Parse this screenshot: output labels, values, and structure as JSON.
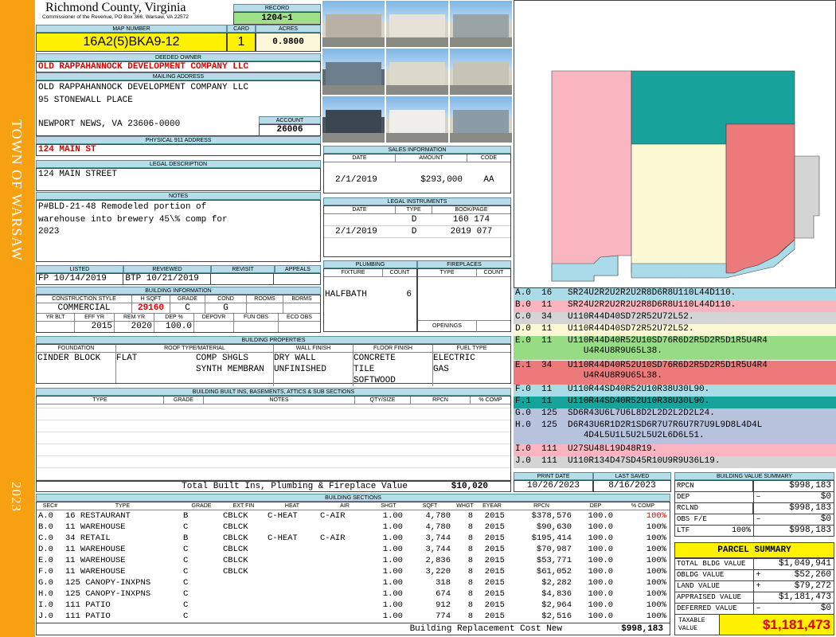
{
  "side": {
    "town": "TOWN OF WARSAW",
    "year": "2023"
  },
  "header": {
    "county": "Richmond County, Virginia",
    "commissioner": "Commissioner of the Revenue, PO Box 366, Warsaw, VA 22572",
    "record_label": "RECORD",
    "record": "1204~1",
    "map_number_label": "MAP NUMBER",
    "map_number": "16A2(5)BKA9-12",
    "card_label": "CARD",
    "card": "1",
    "acres_label": "ACRES",
    "acres": "0.9800"
  },
  "owner": {
    "deeded_label": "DEEDED OWNER",
    "deeded_owner": "OLD RAPPAHANNOCK DEVELOPMENT COMPANY LLC",
    "mailing_label": "MAILING ADDRESS",
    "mailing_line1": "OLD RAPPAHANNOCK DEVELOPMENT COMPANY LLC",
    "mailing_line2": "95 STONEWALL PLACE",
    "mailing_line3": "NEWPORT NEWS, VA 23606-0000",
    "account_label": "ACCOUNT",
    "account": "26006"
  },
  "physical": {
    "label": "PHYSICAL 911 ADDRESS",
    "value": "124 MAIN ST"
  },
  "legal": {
    "label": "LEGAL DESCRIPTION",
    "value": "124 MAIN STREET"
  },
  "notes": {
    "label": "NOTES",
    "line1": "P#BLD-21-48 Remodeled portion of",
    "line2": "warehouse into brewery 45\\% comp for",
    "line3": "2023"
  },
  "dates": {
    "listed_label": "LISTED",
    "listed": "FP  10/14/2019",
    "reviewed_label": "REVIEWED",
    "reviewed": "BTP 10/21/2019",
    "revisit_label": "REVISIT",
    "appeals_label": "APPEALS"
  },
  "building_info": {
    "label": "BUILDING INFORMATION",
    "h_style": "CONSTRUCTION STYLE",
    "h_sqft": "H SQFT",
    "h_grade": "GRADE",
    "h_cond": "COND",
    "h_rooms": "ROOMS",
    "h_bdrms": "BDRMS",
    "style": "COMMERCIAL",
    "sqft": "29160",
    "grade": "C",
    "cond": "G",
    "h_yrblt": "YR BLT",
    "h_effyr": "EFF YR",
    "h_remyr": "REM YR",
    "h_dep": "DEP %",
    "h_depovr": "DEPOVR",
    "h_funobs": "FUN OBS",
    "h_ecoobs": "ECO OBS",
    "effyr": "2015",
    "remyr": "2020",
    "dep": "100.0"
  },
  "sales": {
    "label": "SALES INFORMATION",
    "h_date": "DATE",
    "h_amount": "AMOUNT",
    "h_code": "CODE",
    "date": "2/1/2019",
    "amount": "$293,000",
    "code": "AA"
  },
  "instruments": {
    "label": "LEGAL INSTRUMENTS",
    "h_date": "DATE",
    "h_type": "TYPE",
    "h_book": "BOOK/PAGE",
    "rows": [
      {
        "date": "",
        "type": "D",
        "book": "160 174"
      },
      {
        "date": "2/1/2019",
        "type": "D",
        "book": "2019 077"
      }
    ]
  },
  "plumbing": {
    "label": "PLUMBING",
    "h_fixture": "FIXTURE",
    "h_count": "COUNT",
    "fixture": "HALFBATH",
    "count": "6"
  },
  "fireplaces": {
    "label": "FIREPLACES",
    "h_type": "TYPE",
    "h_count": "COUNT",
    "openings": "OPENINGS"
  },
  "properties": {
    "label": "BUILDING PROPERTIES",
    "h_foundation": "FOUNDATION",
    "h_roof": "ROOF TYPE/MATERIAL",
    "h_wall": "WALL FINISH",
    "h_floor": "FLOOR FINISH",
    "h_fuel": "FUEL TYPE",
    "foundation": "CINDER BLOCK",
    "roof_type": "FLAT",
    "roof_mat1": "COMP SHGLS",
    "roof_mat2": "SYNTH MEMBRAN",
    "wall1": "DRY WALL",
    "wall2": "UNFINISHED",
    "floor1": "CONCRETE",
    "floor2": "TILE",
    "floor3": "SOFTWOOD",
    "fuel1": "ELECTRIC",
    "fuel2": "GAS"
  },
  "builtins": {
    "label": "BUILDING BUILT INS, BASEMENTS, ATTICS & SUB SECTIONS",
    "h_type": "TYPE",
    "h_grade": "GRADE",
    "h_notes": "NOTES",
    "h_qty": "QTY/SIZE",
    "h_rpcn": "RPCN",
    "h_comp": "% COMP",
    "total_label": "Total Built Ins, Plumbing & Fireplace Value",
    "total": "$10,020"
  },
  "print": {
    "print_label": "PRINT DATE",
    "print_date": "10/26/2023",
    "last_label": "LAST SAVED",
    "last_saved": "8/16/2023"
  },
  "sketch": {
    "colors": {
      "pink": "#f9b6c1",
      "teal": "#17a39c",
      "cream": "#fdf8d4",
      "salmon": "#ec7a7a",
      "lightblue": "#a9dbe9",
      "gray": "#d4d4d4",
      "green": "#95dc82",
      "navy": "#b7c3dd"
    },
    "segments": [
      {
        "label": "A.0",
        "code": "16",
        "text": "SR24U2R2U2R2U2R8D6R8U110L44D110."
      },
      {
        "label": "B.0",
        "code": "11",
        "text": "SR24U2R2U2R2U2R8D6R8U110L44D110."
      },
      {
        "label": "C.0",
        "code": "34",
        "text": "U110R44D40SD72R52U72L52."
      },
      {
        "label": "D.0",
        "code": "11",
        "text": "U110R44D40SD72R52U72L52."
      },
      {
        "label": "E.0",
        "code": "11",
        "text": "U110R44D40R52U10SD76R6D2R5D2R5D1R5U4R4",
        "text2": "U4R4U8R9U65L38."
      },
      {
        "label": "E.1",
        "code": "34",
        "text": "U110R44D40R52U10SD76R6D2R5D2R5D1R5U4R4",
        "text2": "U4R4U8R9U65L38."
      },
      {
        "label": "F.0",
        "code": "11",
        "text": "U110R44SD40R52U10R38U30L90."
      },
      {
        "label": "F.1",
        "code": "11",
        "text": "U110R44SD40R52U10R38U30L90."
      },
      {
        "label": "G.0",
        "code": "125",
        "text": "SD6R43U6L7U6L8D2L2D2L2D2L24."
      },
      {
        "label": "H.0",
        "code": "125",
        "text": "D6R43U6R1D2R1SD6R7U7R6U7R7U9L9D8L4D4L",
        "text2": "4D4L5U1L5U2L5U2L6D6L51."
      },
      {
        "label": "I.0",
        "code": "111",
        "text": "U27SU48L19D48R19."
      },
      {
        "label": "J.0",
        "code": "111",
        "text": "U110R134D47SD45R10U9R9U36L19."
      }
    ]
  },
  "value_summary": {
    "label": "BUILDING VALUE SUMMARY",
    "rows": [
      {
        "label": "RPCN",
        "op": "",
        "pct": "",
        "value": "$998,183"
      },
      {
        "label": "DEP",
        "op": "–",
        "pct": "",
        "value": "$0"
      },
      {
        "label": "RCLND",
        "op": "",
        "pct": "",
        "value": "$998,183"
      },
      {
        "label": "OBS F/E",
        "op": "–",
        "pct": "",
        "value": "$0"
      },
      {
        "label": "LTF",
        "op": "",
        "pct": "100%",
        "value": "$998,183"
      }
    ]
  },
  "parcel": {
    "label": "PARCEL SUMMARY",
    "rows": [
      {
        "label": "TOTAL BLDG VALUE",
        "op": "",
        "value": "$1,049,941"
      },
      {
        "label": "OBLDG VALUE",
        "op": "+",
        "value": "$52,260"
      },
      {
        "label": "LAND VALUE",
        "op": "+",
        "value": "$79,272"
      },
      {
        "label": "APPRAISED VALUE",
        "op": "",
        "value": "$1,181,473"
      },
      {
        "label": "DEFERRED VALUE",
        "op": "–",
        "value": "$0"
      }
    ],
    "taxable_label1": "TAXABLE",
    "taxable_label2": "VALUE",
    "taxable": "$1,181,473"
  },
  "sections": {
    "label": "BUILDING SECTIONS",
    "headers": [
      "SEC#",
      "TYPE",
      "GRADE",
      "EXT FIN",
      "HEAT",
      "AIR",
      "SHGT",
      "SQFT",
      "WHGT",
      "EYEAR",
      "RPCN",
      "DEP",
      "% COMP"
    ],
    "rows": [
      [
        "A.0",
        "16 RESTAURANT",
        "B",
        "CBLCK",
        "C-HEAT",
        "C-AIR",
        "1.00",
        "4,780",
        "8",
        "2015",
        "$378,576",
        "100.0",
        "100%"
      ],
      [
        "B.0",
        "11 WAREHOUSE",
        "C",
        "CBLCK",
        "",
        "",
        "1.00",
        "4,780",
        "8",
        "2015",
        "$90,630",
        "100.0",
        "100%"
      ],
      [
        "C.0",
        "34 RETAIL",
        "B",
        "CBLCK",
        "C-HEAT",
        "C-AIR",
        "1.00",
        "3,744",
        "8",
        "2015",
        "$195,414",
        "100.0",
        "100%"
      ],
      [
        "D.0",
        "11 WAREHOUSE",
        "C",
        "CBLCK",
        "",
        "",
        "1.00",
        "3,744",
        "8",
        "2015",
        "$70,987",
        "100.0",
        "100%"
      ],
      [
        "E.0",
        "11 WAREHOUSE",
        "C",
        "CBLCK",
        "",
        "",
        "1.00",
        "2,836",
        "8",
        "2015",
        "$53,771",
        "100.0",
        "100%"
      ],
      [
        "F.0",
        "11 WAREHOUSE",
        "C",
        "CBLCK",
        "",
        "",
        "1.00",
        "3,220",
        "8",
        "2015",
        "$61,052",
        "100.0",
        "100%"
      ],
      [
        "G.0",
        "125 CANOPY-INXPNS",
        "C",
        "",
        "",
        "",
        "1.00",
        "318",
        "8",
        "2015",
        "$2,282",
        "100.0",
        "100%"
      ],
      [
        "H.0",
        "125 CANOPY-INXPNS",
        "C",
        "",
        "",
        "",
        "1.00",
        "674",
        "8",
        "2015",
        "$4,836",
        "100.0",
        "100%"
      ],
      [
        "I.0",
        "111 PATIO",
        "C",
        "",
        "",
        "",
        "1.00",
        "912",
        "8",
        "2015",
        "$2,964",
        "100.0",
        "100%"
      ],
      [
        "J.0",
        "111 PATIO",
        "C",
        "",
        "",
        "",
        "1.00",
        "774",
        "8",
        "2015",
        "$2,516",
        "100.0",
        "100%"
      ]
    ],
    "replacement_label": "Building Replacement Cost New",
    "replacement": "$998,183"
  }
}
